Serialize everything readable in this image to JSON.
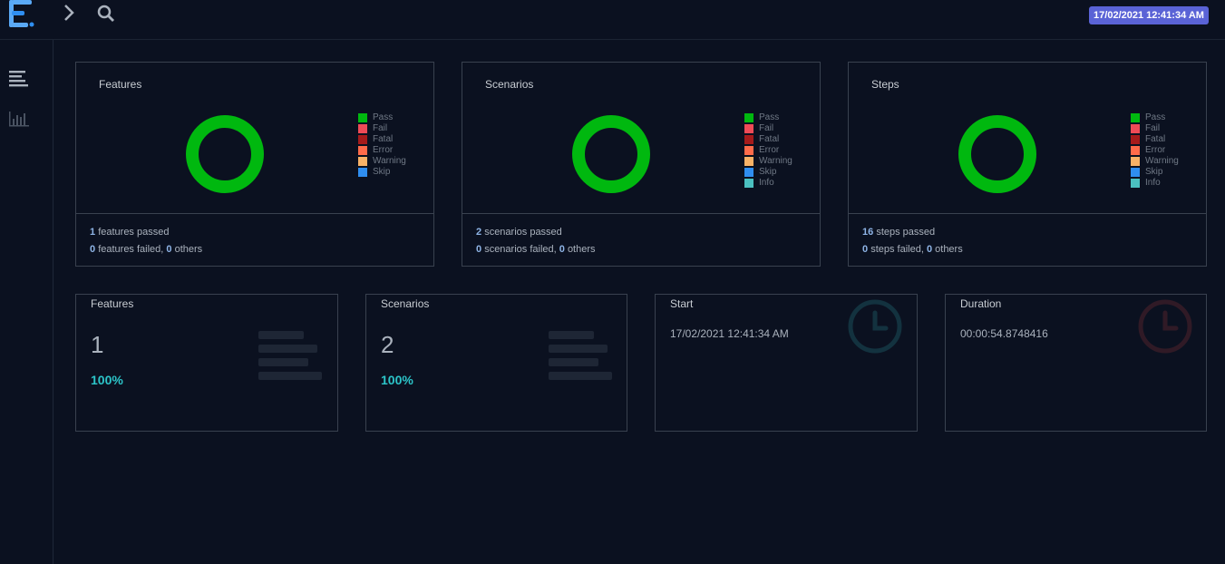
{
  "header": {
    "timestamp_badge": "17/02/2021 12:41:34 AM",
    "icons": [
      "logo-icon",
      "chevron-right-icon",
      "search-icon"
    ]
  },
  "sidebar": {
    "items": [
      {
        "icon": "dashboard-list-icon"
      },
      {
        "icon": "bar-chart-icon"
      }
    ]
  },
  "colors": {
    "pass": "#00b80f",
    "fail": "#ef4b57",
    "fatal": "#a61b1b",
    "error": "#ff6b4a",
    "warning": "#f7b267",
    "skip": "#2f8ef0",
    "info": "#4bc0c0",
    "badge": "#5a63d6",
    "accent_percent": "#2cc5c9"
  },
  "charts": [
    {
      "title": "Features",
      "legend": [
        "Pass",
        "Fail",
        "Fatal",
        "Error",
        "Warning",
        "Skip"
      ],
      "passed_count": "1",
      "passed_text": "features passed",
      "failed_count": "0",
      "failed_text": "features failed,",
      "others_count": "0",
      "others_text": "others"
    },
    {
      "title": "Scenarios",
      "legend": [
        "Pass",
        "Fail",
        "Fatal",
        "Error",
        "Warning",
        "Skip",
        "Info"
      ],
      "passed_count": "2",
      "passed_text": "scenarios passed",
      "failed_count": "0",
      "failed_text": "scenarios failed,",
      "others_count": "0",
      "others_text": "others"
    },
    {
      "title": "Steps",
      "legend": [
        "Pass",
        "Fail",
        "Fatal",
        "Error",
        "Warning",
        "Skip",
        "Info"
      ],
      "passed_count": "16",
      "passed_text": "steps passed",
      "failed_count": "0",
      "failed_text": "steps failed,",
      "others_count": "0",
      "others_text": "others"
    }
  ],
  "stats": {
    "features": {
      "title": "Features",
      "value": "1",
      "percent": "100%"
    },
    "scenarios": {
      "title": "Scenarios",
      "value": "2",
      "percent": "100%"
    },
    "start": {
      "title": "Start",
      "text": "17/02/2021 12:41:34 AM",
      "icon": "clock-icon"
    },
    "duration": {
      "title": "Duration",
      "text": "00:00:54.8748416",
      "icon": "clock-icon"
    }
  }
}
